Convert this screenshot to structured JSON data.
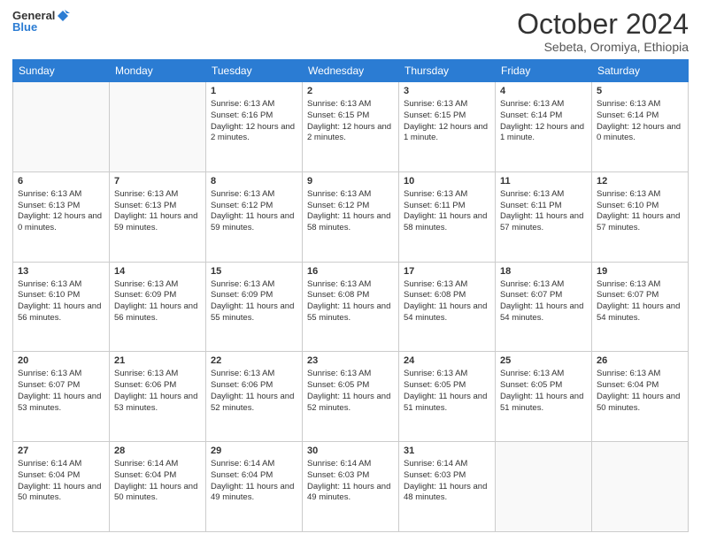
{
  "header": {
    "logo_general": "General",
    "logo_blue": "Blue",
    "month_title": "October 2024",
    "location": "Sebeta, Oromiya, Ethiopia"
  },
  "weekdays": [
    "Sunday",
    "Monday",
    "Tuesday",
    "Wednesday",
    "Thursday",
    "Friday",
    "Saturday"
  ],
  "weeks": [
    [
      {
        "day": "",
        "empty": true
      },
      {
        "day": "",
        "empty": true
      },
      {
        "day": "1",
        "sunrise": "Sunrise: 6:13 AM",
        "sunset": "Sunset: 6:16 PM",
        "daylight": "Daylight: 12 hours and 2 minutes."
      },
      {
        "day": "2",
        "sunrise": "Sunrise: 6:13 AM",
        "sunset": "Sunset: 6:15 PM",
        "daylight": "Daylight: 12 hours and 2 minutes."
      },
      {
        "day": "3",
        "sunrise": "Sunrise: 6:13 AM",
        "sunset": "Sunset: 6:15 PM",
        "daylight": "Daylight: 12 hours and 1 minute."
      },
      {
        "day": "4",
        "sunrise": "Sunrise: 6:13 AM",
        "sunset": "Sunset: 6:14 PM",
        "daylight": "Daylight: 12 hours and 1 minute."
      },
      {
        "day": "5",
        "sunrise": "Sunrise: 6:13 AM",
        "sunset": "Sunset: 6:14 PM",
        "daylight": "Daylight: 12 hours and 0 minutes."
      }
    ],
    [
      {
        "day": "6",
        "sunrise": "Sunrise: 6:13 AM",
        "sunset": "Sunset: 6:13 PM",
        "daylight": "Daylight: 12 hours and 0 minutes."
      },
      {
        "day": "7",
        "sunrise": "Sunrise: 6:13 AM",
        "sunset": "Sunset: 6:13 PM",
        "daylight": "Daylight: 11 hours and 59 minutes."
      },
      {
        "day": "8",
        "sunrise": "Sunrise: 6:13 AM",
        "sunset": "Sunset: 6:12 PM",
        "daylight": "Daylight: 11 hours and 59 minutes."
      },
      {
        "day": "9",
        "sunrise": "Sunrise: 6:13 AM",
        "sunset": "Sunset: 6:12 PM",
        "daylight": "Daylight: 11 hours and 58 minutes."
      },
      {
        "day": "10",
        "sunrise": "Sunrise: 6:13 AM",
        "sunset": "Sunset: 6:11 PM",
        "daylight": "Daylight: 11 hours and 58 minutes."
      },
      {
        "day": "11",
        "sunrise": "Sunrise: 6:13 AM",
        "sunset": "Sunset: 6:11 PM",
        "daylight": "Daylight: 11 hours and 57 minutes."
      },
      {
        "day": "12",
        "sunrise": "Sunrise: 6:13 AM",
        "sunset": "Sunset: 6:10 PM",
        "daylight": "Daylight: 11 hours and 57 minutes."
      }
    ],
    [
      {
        "day": "13",
        "sunrise": "Sunrise: 6:13 AM",
        "sunset": "Sunset: 6:10 PM",
        "daylight": "Daylight: 11 hours and 56 minutes."
      },
      {
        "day": "14",
        "sunrise": "Sunrise: 6:13 AM",
        "sunset": "Sunset: 6:09 PM",
        "daylight": "Daylight: 11 hours and 56 minutes."
      },
      {
        "day": "15",
        "sunrise": "Sunrise: 6:13 AM",
        "sunset": "Sunset: 6:09 PM",
        "daylight": "Daylight: 11 hours and 55 minutes."
      },
      {
        "day": "16",
        "sunrise": "Sunrise: 6:13 AM",
        "sunset": "Sunset: 6:08 PM",
        "daylight": "Daylight: 11 hours and 55 minutes."
      },
      {
        "day": "17",
        "sunrise": "Sunrise: 6:13 AM",
        "sunset": "Sunset: 6:08 PM",
        "daylight": "Daylight: 11 hours and 54 minutes."
      },
      {
        "day": "18",
        "sunrise": "Sunrise: 6:13 AM",
        "sunset": "Sunset: 6:07 PM",
        "daylight": "Daylight: 11 hours and 54 minutes."
      },
      {
        "day": "19",
        "sunrise": "Sunrise: 6:13 AM",
        "sunset": "Sunset: 6:07 PM",
        "daylight": "Daylight: 11 hours and 54 minutes."
      }
    ],
    [
      {
        "day": "20",
        "sunrise": "Sunrise: 6:13 AM",
        "sunset": "Sunset: 6:07 PM",
        "daylight": "Daylight: 11 hours and 53 minutes."
      },
      {
        "day": "21",
        "sunrise": "Sunrise: 6:13 AM",
        "sunset": "Sunset: 6:06 PM",
        "daylight": "Daylight: 11 hours and 53 minutes."
      },
      {
        "day": "22",
        "sunrise": "Sunrise: 6:13 AM",
        "sunset": "Sunset: 6:06 PM",
        "daylight": "Daylight: 11 hours and 52 minutes."
      },
      {
        "day": "23",
        "sunrise": "Sunrise: 6:13 AM",
        "sunset": "Sunset: 6:05 PM",
        "daylight": "Daylight: 11 hours and 52 minutes."
      },
      {
        "day": "24",
        "sunrise": "Sunrise: 6:13 AM",
        "sunset": "Sunset: 6:05 PM",
        "daylight": "Daylight: 11 hours and 51 minutes."
      },
      {
        "day": "25",
        "sunrise": "Sunrise: 6:13 AM",
        "sunset": "Sunset: 6:05 PM",
        "daylight": "Daylight: 11 hours and 51 minutes."
      },
      {
        "day": "26",
        "sunrise": "Sunrise: 6:13 AM",
        "sunset": "Sunset: 6:04 PM",
        "daylight": "Daylight: 11 hours and 50 minutes."
      }
    ],
    [
      {
        "day": "27",
        "sunrise": "Sunrise: 6:14 AM",
        "sunset": "Sunset: 6:04 PM",
        "daylight": "Daylight: 11 hours and 50 minutes."
      },
      {
        "day": "28",
        "sunrise": "Sunrise: 6:14 AM",
        "sunset": "Sunset: 6:04 PM",
        "daylight": "Daylight: 11 hours and 50 minutes."
      },
      {
        "day": "29",
        "sunrise": "Sunrise: 6:14 AM",
        "sunset": "Sunset: 6:04 PM",
        "daylight": "Daylight: 11 hours and 49 minutes."
      },
      {
        "day": "30",
        "sunrise": "Sunrise: 6:14 AM",
        "sunset": "Sunset: 6:03 PM",
        "daylight": "Daylight: 11 hours and 49 minutes."
      },
      {
        "day": "31",
        "sunrise": "Sunrise: 6:14 AM",
        "sunset": "Sunset: 6:03 PM",
        "daylight": "Daylight: 11 hours and 48 minutes."
      },
      {
        "day": "",
        "empty": true
      },
      {
        "day": "",
        "empty": true
      }
    ]
  ]
}
